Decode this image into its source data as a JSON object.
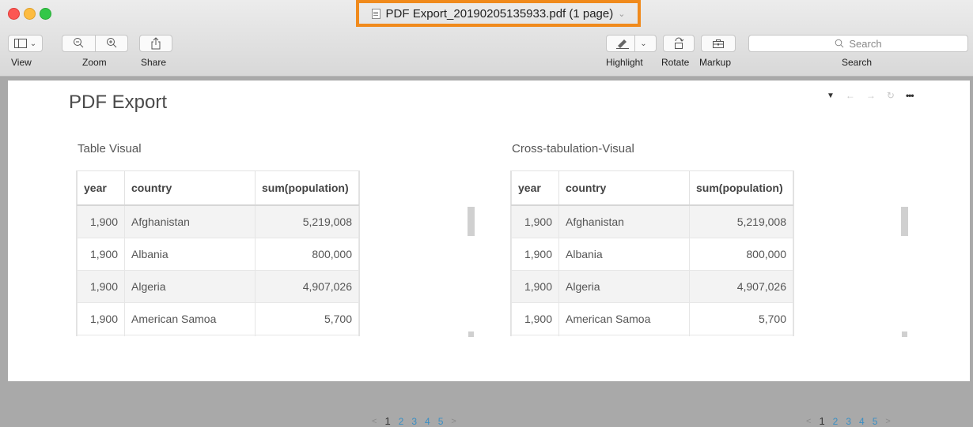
{
  "window": {
    "title": "PDF Export_20190205135933.pdf (1 page)"
  },
  "toolbar": {
    "view_label": "View",
    "zoom_label": "Zoom",
    "share_label": "Share",
    "highlight_label": "Highlight",
    "rotate_label": "Rotate",
    "markup_label": "Markup",
    "search_label": "Search",
    "search_placeholder": "Search"
  },
  "page": {
    "title": "PDF Export"
  },
  "visuals": [
    {
      "title": "Table Visual",
      "columns": [
        "year",
        "country",
        "sum(population)"
      ],
      "rows": [
        [
          "1,900",
          "Afghanistan",
          "5,219,008"
        ],
        [
          "1,900",
          "Albania",
          "800,000"
        ],
        [
          "1,900",
          "Algeria",
          "4,907,026"
        ],
        [
          "1,900",
          "American Samoa",
          "5,700"
        ]
      ],
      "pager": {
        "prev": "<",
        "pages": [
          "1",
          "2",
          "3",
          "4",
          "5"
        ],
        "next": ">"
      }
    },
    {
      "title": "Cross-tabulation-Visual",
      "columns": [
        "year",
        "country",
        "sum(population)"
      ],
      "rows": [
        [
          "1,900",
          "Afghanistan",
          "5,219,008"
        ],
        [
          "1,900",
          "Albania",
          "800,000"
        ],
        [
          "1,900",
          "Algeria",
          "4,907,026"
        ],
        [
          "1,900",
          "American Samoa",
          "5,700"
        ]
      ],
      "pager": {
        "prev": "<",
        "pages": [
          "1",
          "2",
          "3",
          "4",
          "5"
        ],
        "next": ">"
      }
    }
  ],
  "colors": {
    "title_highlight": "#f08a1c",
    "link": "#3b8fc4"
  }
}
